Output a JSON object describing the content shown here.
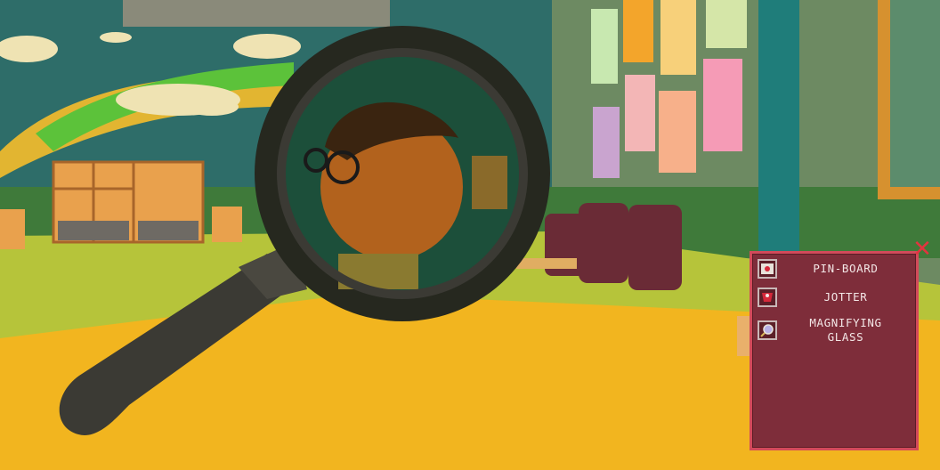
{
  "colors": {
    "panel_bg": "#7e2d3a",
    "panel_border": "#d24a5a",
    "close": "#e2343f",
    "label_text": "#f3e6e6",
    "floor": "#f2b51f",
    "carpet": "#b6c43a"
  },
  "inventory": {
    "close_icon": "x-icon",
    "items": [
      {
        "label": "PIN-BOARD",
        "icon": "pin-board-icon"
      },
      {
        "label": "JOTTER",
        "icon": "jotter-icon"
      },
      {
        "label": "MAGNIFYING\nGLASS",
        "icon": "magnifying-glass-icon"
      }
    ]
  }
}
